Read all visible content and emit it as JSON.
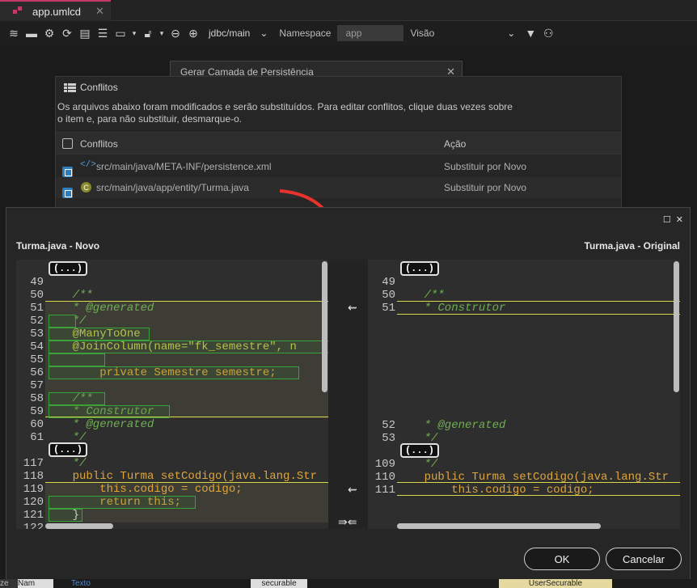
{
  "tab": {
    "label": "app.umlcd",
    "close": "✕"
  },
  "toolbar": {
    "datasource": "jdbc/main",
    "namespace_label": "Namespace",
    "namespace_value": "app",
    "view_label": "Visão",
    "view_value": ""
  },
  "bg_dialog": {
    "title": "Gerar Camada de Persistência",
    "close": "✕"
  },
  "conflicts": {
    "title": "Conflitos",
    "description_line1": "Os arquivos abaixo foram modificados e serão substituídos. Para editar conflitos, clique duas vezes sobre",
    "description_line2": "o item e, para não substituir, desmarque-o.",
    "col_conflicts": "Conflitos",
    "col_action": "Ação",
    "rows": [
      {
        "path": "src/main/java/META-INF/persistence.xml",
        "action": "Substituir por Novo",
        "checked": true,
        "icon": "xml-icon"
      },
      {
        "path": "src/main/java/app/entity/Turma.java",
        "action": "Substituir por Novo",
        "checked": true,
        "icon": "class-icon"
      }
    ]
  },
  "diff": {
    "left_title": "Turma.java - Novo",
    "right_title": "Turma.java - Original",
    "fold_label": "(...)",
    "left_lines": [
      {
        "n": "49",
        "t": ""
      },
      {
        "n": "50",
        "t": "    /**"
      },
      {
        "n": "51",
        "t": "    * @generated"
      },
      {
        "n": "52",
        "t": "    */"
      },
      {
        "n": "53",
        "t": "    @ManyToOne"
      },
      {
        "n": "54",
        "t": "    @JoinColumn(name=\"fk_semestre\", n"
      },
      {
        "n": "55",
        "t": ""
      },
      {
        "n": "56",
        "t": "        private Semestre semestre;"
      },
      {
        "n": "57",
        "t": ""
      },
      {
        "n": "58",
        "t": "    /**"
      },
      {
        "n": "59",
        "t": "    * Construtor"
      },
      {
        "n": "60",
        "t": "    * @generated"
      },
      {
        "n": "61",
        "t": "    */"
      },
      {
        "n": "117",
        "t": "    */"
      },
      {
        "n": "118",
        "t": "    public Turma setCodigo(java.lang.Str"
      },
      {
        "n": "119",
        "t": "        this.codigo = codigo;"
      },
      {
        "n": "120",
        "t": "        return this;"
      },
      {
        "n": "121",
        "t": "    }"
      },
      {
        "n": "122",
        "t": ""
      }
    ],
    "right_lines": [
      {
        "n": "49",
        "t": ""
      },
      {
        "n": "50",
        "t": "    /**"
      },
      {
        "n": "51",
        "t": "    * Construtor"
      },
      {
        "n": "52",
        "t": "    * @generated"
      },
      {
        "n": "53",
        "t": "    */"
      },
      {
        "n": "109",
        "t": "    */"
      },
      {
        "n": "110",
        "t": "    public Turma setCodigo(java.lang.Str"
      },
      {
        "n": "111",
        "t": "        this.codigo = codigo;"
      }
    ]
  },
  "buttons": {
    "ok": "OK",
    "cancel": "Cancelar"
  },
  "bottom_strip": {
    "a": "ze",
    "b": "Nam",
    "c": "Texto",
    "d": "securable",
    "e": "UserSecurable"
  },
  "colors": {
    "accent": "#c33a6a",
    "comment": "#6fae52",
    "keyword": "#e0a53a",
    "annotation": "#c8c851",
    "diff_border": "#3aa03a",
    "arrow": "#e8322b"
  }
}
